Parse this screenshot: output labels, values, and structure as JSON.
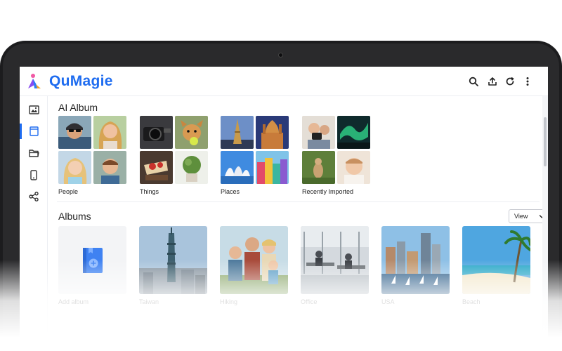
{
  "app": {
    "name": "QuMagie"
  },
  "header": {
    "icons": [
      "search-icon",
      "upload-icon",
      "refresh-icon",
      "more-vertical-icon"
    ]
  },
  "sidebar": {
    "items": [
      {
        "icon": "photos-icon",
        "active": false
      },
      {
        "icon": "album-icon",
        "active": true
      },
      {
        "icon": "folder-icon",
        "active": false
      },
      {
        "icon": "mobile-icon",
        "active": false
      },
      {
        "icon": "share-icon",
        "active": false
      }
    ]
  },
  "ai_album": {
    "title": "AI Album",
    "groups": [
      {
        "label": "People"
      },
      {
        "label": "Things"
      },
      {
        "label": "Places"
      },
      {
        "label": "Recently Imported"
      }
    ]
  },
  "albums": {
    "title": "Albums",
    "view_label": "View",
    "items": [
      {
        "label": "Add album"
      },
      {
        "label": "Taiwan"
      },
      {
        "label": "Hiking"
      },
      {
        "label": "Office"
      },
      {
        "label": "USA"
      },
      {
        "label": "Beach"
      }
    ]
  },
  "colors": {
    "accent": "#1e6cf0",
    "add_album_book": "#3f82f2"
  }
}
